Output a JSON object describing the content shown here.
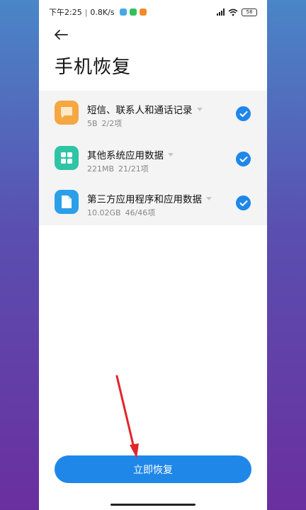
{
  "status_bar": {
    "time": "下午2:25",
    "separator": "|",
    "speed": "0.8K/s",
    "battery": "58"
  },
  "header": {
    "title": "手机恢复"
  },
  "items": [
    {
      "title": "短信、联系人和通话记录",
      "size": "5B",
      "count": "2/2项",
      "icon": "message-icon",
      "color": "#f5a742"
    },
    {
      "title": "其他系统应用数据",
      "size": "221MB",
      "count": "21/21项",
      "icon": "apps-grid-icon",
      "color": "#2ec4a6"
    },
    {
      "title": "第三方应用程序和应用数据",
      "size": "10.02GB",
      "count": "46/46项",
      "icon": "document-icon",
      "color": "#2b9fe8"
    }
  ],
  "footer": {
    "button_label": "立即恢复"
  },
  "colors": {
    "accent": "#1f87e8",
    "annotation_arrow": "#e0252b"
  }
}
